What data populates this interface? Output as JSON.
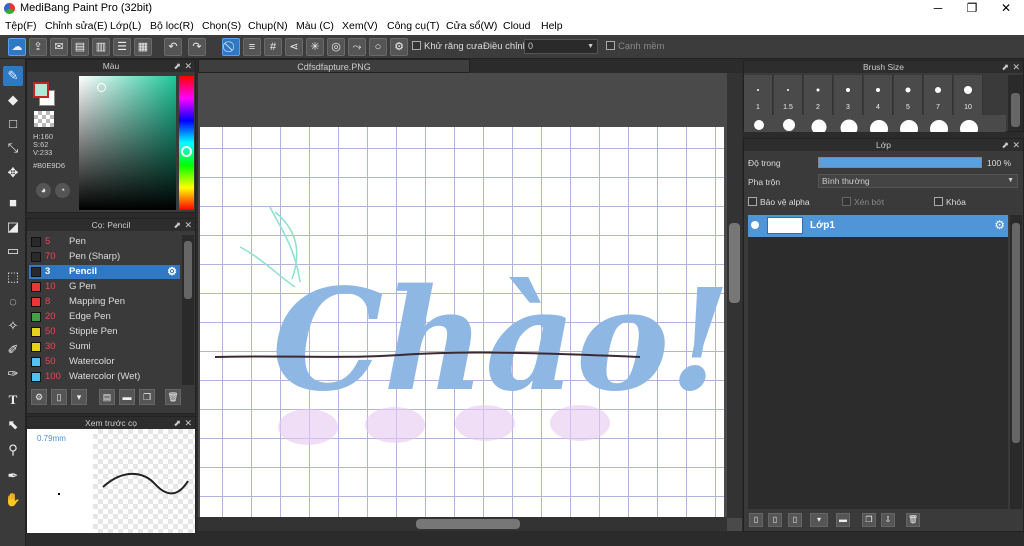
{
  "window": {
    "title": "MediBang Paint Pro (32bit)",
    "min": "─",
    "max": "❐",
    "close": "✕"
  },
  "menu": [
    "Tệp(F)",
    "Chỉnh sửa(E)",
    "Lớp(L)",
    "Bộ lọc(R)",
    "Chọn(S)",
    "Chụp(N)",
    "Màu (C)",
    "Xem(V)",
    "Công cụ(T)",
    "Cửa sổ(W)",
    "Cloud",
    "Help"
  ],
  "toolbar": {
    "antialias_label": "Khử răng cưa",
    "correction_label": "Điều chỉnh",
    "correction_value": "0",
    "smooth_label": "Cạnh mềm"
  },
  "color_panel": {
    "title": "Màu",
    "h": "H:160",
    "s": "S:62",
    "v": "V:233",
    "hex": "#B0E9D6"
  },
  "brush_panel": {
    "title": "Cọ: Pencil",
    "items": [
      {
        "size": "5",
        "name": "Pen",
        "color": "#2a2a2a"
      },
      {
        "size": "70",
        "name": "Pen (Sharp)",
        "color": "#2a2a2a"
      },
      {
        "size": "3",
        "name": "Pencil",
        "color": "#2a2a2a"
      },
      {
        "size": "10",
        "name": "G Pen",
        "color": "#e53935"
      },
      {
        "size": "8",
        "name": "Mapping Pen",
        "color": "#e53935"
      },
      {
        "size": "20",
        "name": "Edge Pen",
        "color": "#43a047"
      },
      {
        "size": "50",
        "name": "Stipple Pen",
        "color": "#e6d21a"
      },
      {
        "size": "30",
        "name": "Sumi",
        "color": "#e6d21a"
      },
      {
        "size": "50",
        "name": "Watercolor",
        "color": "#4fc3f7"
      },
      {
        "size": "100",
        "name": "Watercolor (Wet)",
        "color": "#4fc3f7"
      }
    ]
  },
  "preview_panel": {
    "title": "Xem trước cọ",
    "size": "0.79mm"
  },
  "document": {
    "tab": "Cdfsdfapture.PNG",
    "artwork_text": "Chào!"
  },
  "brush_size_panel": {
    "title": "Brush Size",
    "sizes": [
      "1",
      "1.5",
      "2",
      "3",
      "4",
      "5",
      "7",
      "10"
    ]
  },
  "layer_panel": {
    "title": "Lớp",
    "opacity_label": "Độ trong",
    "opacity_value": "100 %",
    "opacity": 1.0,
    "blend_label": "Pha trộn",
    "blend_value": "Bình thường",
    "protect_alpha": "Bảo vệ alpha",
    "clipping": "Xén bớt",
    "lock": "Khóa",
    "layer_name": "Lớp1"
  },
  "colors": {
    "accent": "#2f78c4",
    "current_color": "#B0E9D6"
  }
}
